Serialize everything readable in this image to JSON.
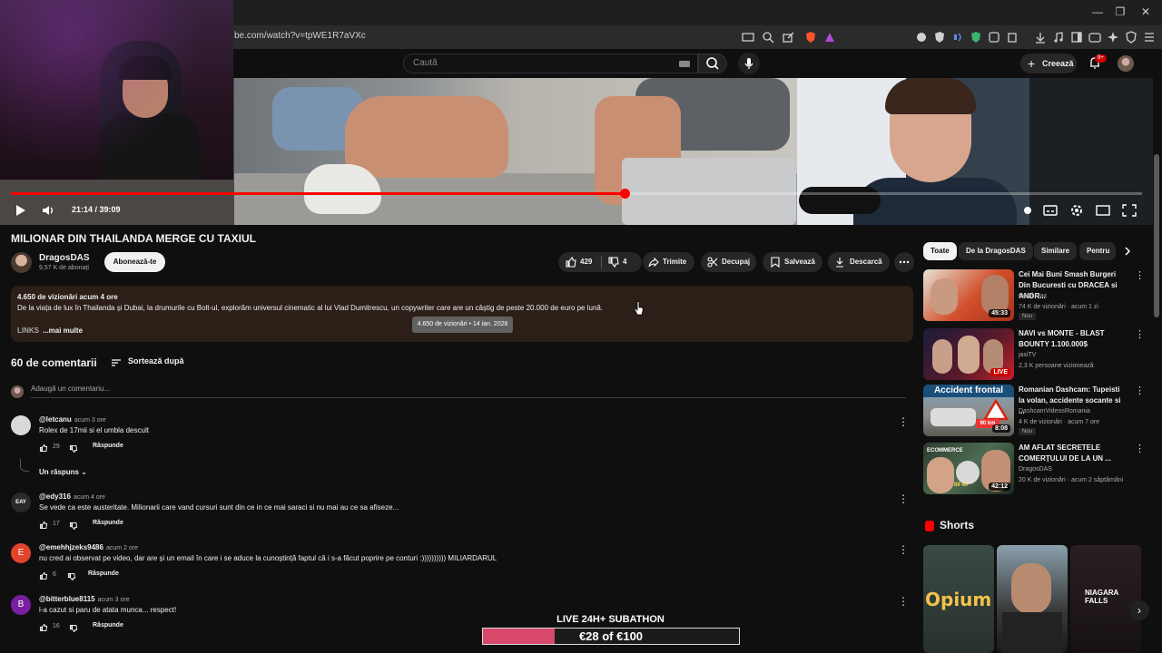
{
  "browser": {
    "url": "be.com/watch?v=tpWE1R7aVXc",
    "window_controls": [
      "—",
      "❐",
      "✕"
    ]
  },
  "youtube": {
    "search_placeholder": "Caută",
    "create_label": "Creează",
    "notifications_badge": "9+"
  },
  "player": {
    "time": "21:14 / 39:09",
    "progress_fraction": 0.5425
  },
  "video": {
    "title": "MILIONAR DIN THAILANDA MERGE CU TAXIUL",
    "channel_name": "DragosDAS",
    "channel_subs": "9,57 K de abonați",
    "subscribe_label": "Abonează-te",
    "likes": "429",
    "dislikes": "4",
    "share_label": "Trimite",
    "clip_label": "Decupaj",
    "save_label": "Salvează",
    "download_label": "Descarcă"
  },
  "description": {
    "meta": "4.650 de vizionări  acum 4 ore",
    "text": "De la viața de lux în Thailanda și Dubai, la drumurile cu Bolt-ul, explorăm universul cinematic al lui Vlad Dumitrescu, un copywriter care are un câștig de peste 20.000 de euro pe lună.",
    "links": "LINKS",
    "more": "...mai multe",
    "tooltip": "4.650 de vizionări • 14 ian. 2026"
  },
  "comments_section": {
    "count_label": "60 de comentarii",
    "sort_label": "Sortează după",
    "add_placeholder": "Adaugă un comentariu...",
    "replies_label": "Un răspuns",
    "items": [
      {
        "user": "@letcanu",
        "time": "acum 3 ore",
        "text": "Rolex de 17mii si el umbla descult",
        "likes": "29",
        "reply": "Răspunde",
        "avatar_color": "#d9d9d9",
        "initial": ""
      },
      {
        "user": "@edy316",
        "time": "acum 4 ore",
        "text": "Se vede ca este austeritate. Milionarii care vand cursuri sunt din ce in ce mai saraci si nu mai au ce sa afiseze...",
        "likes": "17",
        "reply": "Răspunde",
        "avatar_color": "#2a2a2a",
        "initial": "EAY"
      },
      {
        "user": "@emehhjzeks9486",
        "time": "acum 2 ore",
        "text": "nu cred ai observat pe video, dar are și un email în care i se aduce la cunoștință faptul că i s-a făcut poprire pe conturi :)))))))))) MILIARDARUL",
        "likes": "6",
        "reply": "Răspunde",
        "avatar_color": "#e2432a",
        "initial": "E"
      },
      {
        "user": "@bitterblue8115",
        "time": "acum 3 ore",
        "text": "l-a cazut si paru de atata munca... respect!",
        "likes": "16",
        "reply": "Răspunde",
        "avatar_color": "#7b1fa2",
        "initial": "B"
      }
    ]
  },
  "sidebar": {
    "chips": [
      "Toate",
      "De la DragosDAS",
      "Similare",
      "Pentru"
    ],
    "recommendations": [
      {
        "title": "Cei Mai Buni Smash Burgeri Din Bucuresti cu DRACEA si ANDR...",
        "channel": "Costi Max",
        "meta": "74 K de vizionări · acum 1 zi",
        "badge": "Nou",
        "duration": "45:33",
        "live": ""
      },
      {
        "title": "NAVI vs MONTE - BLAST BOUNTY 1.100.000$",
        "channel": "jaxiTV",
        "meta": "2,3 K persoane vizionează",
        "badge": "",
        "duration": "",
        "live": "LIVE"
      },
      {
        "title": "Romanian Dashcam: Tupeisti la volan, accidente socante si ...",
        "channel": "DashcamVideosRomania",
        "meta": "4 K de vizionări · acum 7 ore",
        "badge": "Nou",
        "duration": "8:08",
        "live": ""
      },
      {
        "title": "AM AFLAT SECRETELE COMERȚULUI DE LA UN ...",
        "channel": "DragosDAS",
        "meta": "20 K de vizionări · acum 2 săptămâni",
        "badge": "",
        "duration": "42:12",
        "live": ""
      }
    ],
    "thumb_texts": {
      "accident": "Accident frontal",
      "speed": "90 km",
      "ecommerce": "ECOMMERCE",
      "price": "89 lei"
    },
    "shorts_label": "Shorts",
    "shorts_texts": [
      "Opium",
      "",
      "NIAGARA FALLS"
    ]
  },
  "subathon": {
    "title": "LIVE 24H+ SUBATHON",
    "amount": "€28 of €100",
    "progress_fraction": 0.28
  }
}
